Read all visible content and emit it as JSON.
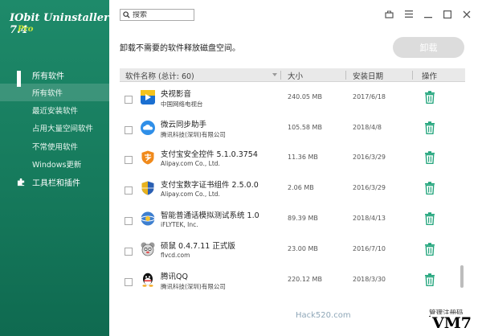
{
  "app": {
    "title": "IObit Uninstaller 7.4",
    "edition": "Pro"
  },
  "sidebar": {
    "groups": [
      {
        "label": "所有软件",
        "icon": "grid-icon"
      },
      {
        "label": "工具栏和插件",
        "icon": "puzzle-icon"
      }
    ],
    "items": [
      {
        "label": "所有软件",
        "active": true
      },
      {
        "label": "最近安装软件"
      },
      {
        "label": "占用大量空间软件"
      },
      {
        "label": "不常使用软件"
      },
      {
        "label": "Windows更新"
      }
    ]
  },
  "search": {
    "placeholder": "搜索"
  },
  "header": {
    "subtitle": "卸载不需要的软件释放磁盘空间。",
    "uninstall_label": "卸载"
  },
  "table": {
    "columns": {
      "name": "软件名称 (总计: 60)",
      "size": "大小",
      "date": "安装日期",
      "action": "操作"
    },
    "rows": [
      {
        "name": "央视影音",
        "publisher": "中国网络电视台",
        "size": "240.05 MB",
        "date": "2017/6/18",
        "icon": "cctv-icon"
      },
      {
        "name": "微云同步助手",
        "publisher": "腾讯科技(深圳)有限公司",
        "size": "105.58 MB",
        "date": "2018/4/8",
        "icon": "weiyun-icon"
      },
      {
        "name": "支付宝安全控件 5.1.0.3754",
        "publisher": "Alipay.com Co., Ltd.",
        "size": "11.36 MB",
        "date": "2016/3/29",
        "icon": "alipay-icon"
      },
      {
        "name": "支付宝数字证书组件 2.5.0.0",
        "publisher": "Alipay.com Co., Ltd.",
        "size": "2.06 MB",
        "date": "2016/3/29",
        "icon": "shield-icon"
      },
      {
        "name": "智能普通话模拟测试系统 1.0",
        "publisher": "iFLYTEK, Inc.",
        "size": "89.39 MB",
        "date": "2018/4/13",
        "icon": "iflytek-icon"
      },
      {
        "name": "硕鼠 0.4.7.11 正式版",
        "publisher": "flvcd.com",
        "size": "23.00 MB",
        "date": "2016/7/10",
        "icon": "mouse-icon"
      },
      {
        "name": "腾讯QQ",
        "publisher": "腾讯科技(深圳)有限公司",
        "size": "220.12 MB",
        "date": "2018/3/30",
        "icon": "qq-icon"
      }
    ]
  },
  "footer": {
    "watermark": "Hack520.com",
    "manage_link": "管理注册码",
    "badge": "VM7"
  },
  "colors": {
    "sidebar": "#1a8363",
    "accent_trash": "#22a57c",
    "disabled_button": "#dcdcdc"
  }
}
